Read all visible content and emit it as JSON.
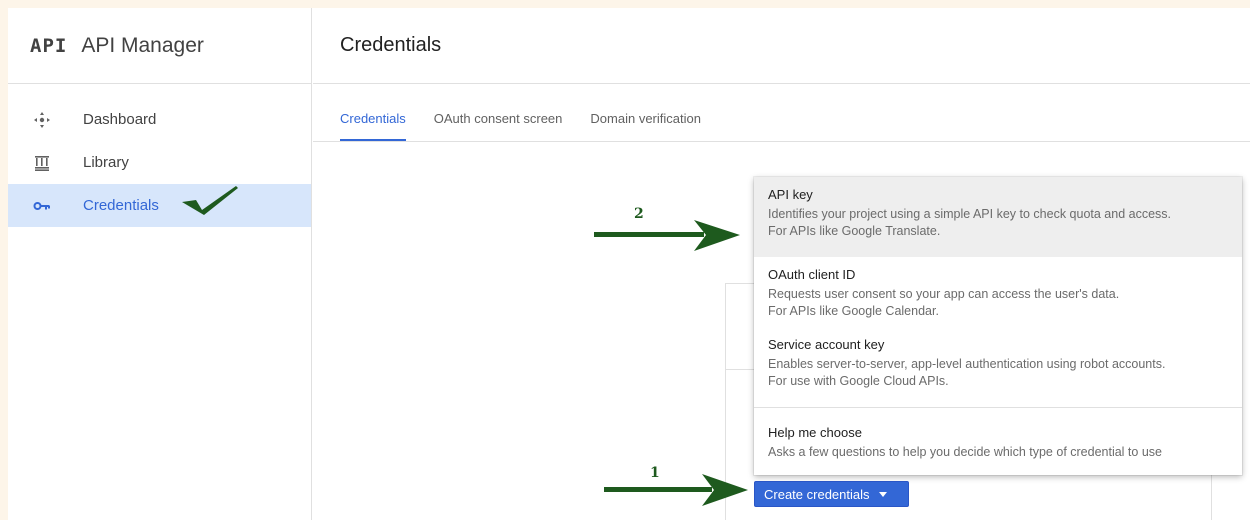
{
  "app": {
    "logo": "API",
    "title": "API Manager"
  },
  "sidebar": {
    "items": [
      {
        "label": "Dashboard",
        "icon": "dashboard-icon"
      },
      {
        "label": "Library",
        "icon": "library-icon"
      },
      {
        "label": "Credentials",
        "icon": "key-icon",
        "active": true
      }
    ]
  },
  "header": {
    "title": "Credentials"
  },
  "tabs": [
    {
      "label": "Credentials",
      "active": true
    },
    {
      "label": "OAuth consent screen"
    },
    {
      "label": "Domain verification"
    }
  ],
  "menu": {
    "items": [
      {
        "title": "API key",
        "desc1": "Identifies your project using a simple API key to check quota and access.",
        "desc2": "For APIs like Google Translate."
      },
      {
        "title": "OAuth client ID",
        "desc1": "Requests user consent so your app can access the user's data.",
        "desc2": "For APIs like Google Calendar."
      },
      {
        "title": "Service account key",
        "desc1": "Enables server-to-server, app-level authentication using robot accounts.",
        "desc2": "For use with Google Cloud APIs."
      },
      {
        "title": "Help me choose",
        "desc1": "Asks a few questions to help you decide which type of credential to use"
      }
    ]
  },
  "create_button": {
    "label": "Create credentials"
  },
  "annotations": {
    "step1": "1",
    "step2": "2"
  },
  "colors": {
    "accent": "#3367d6",
    "annotation": "#1e5a1e",
    "active_bg": "#d7e6fb"
  }
}
